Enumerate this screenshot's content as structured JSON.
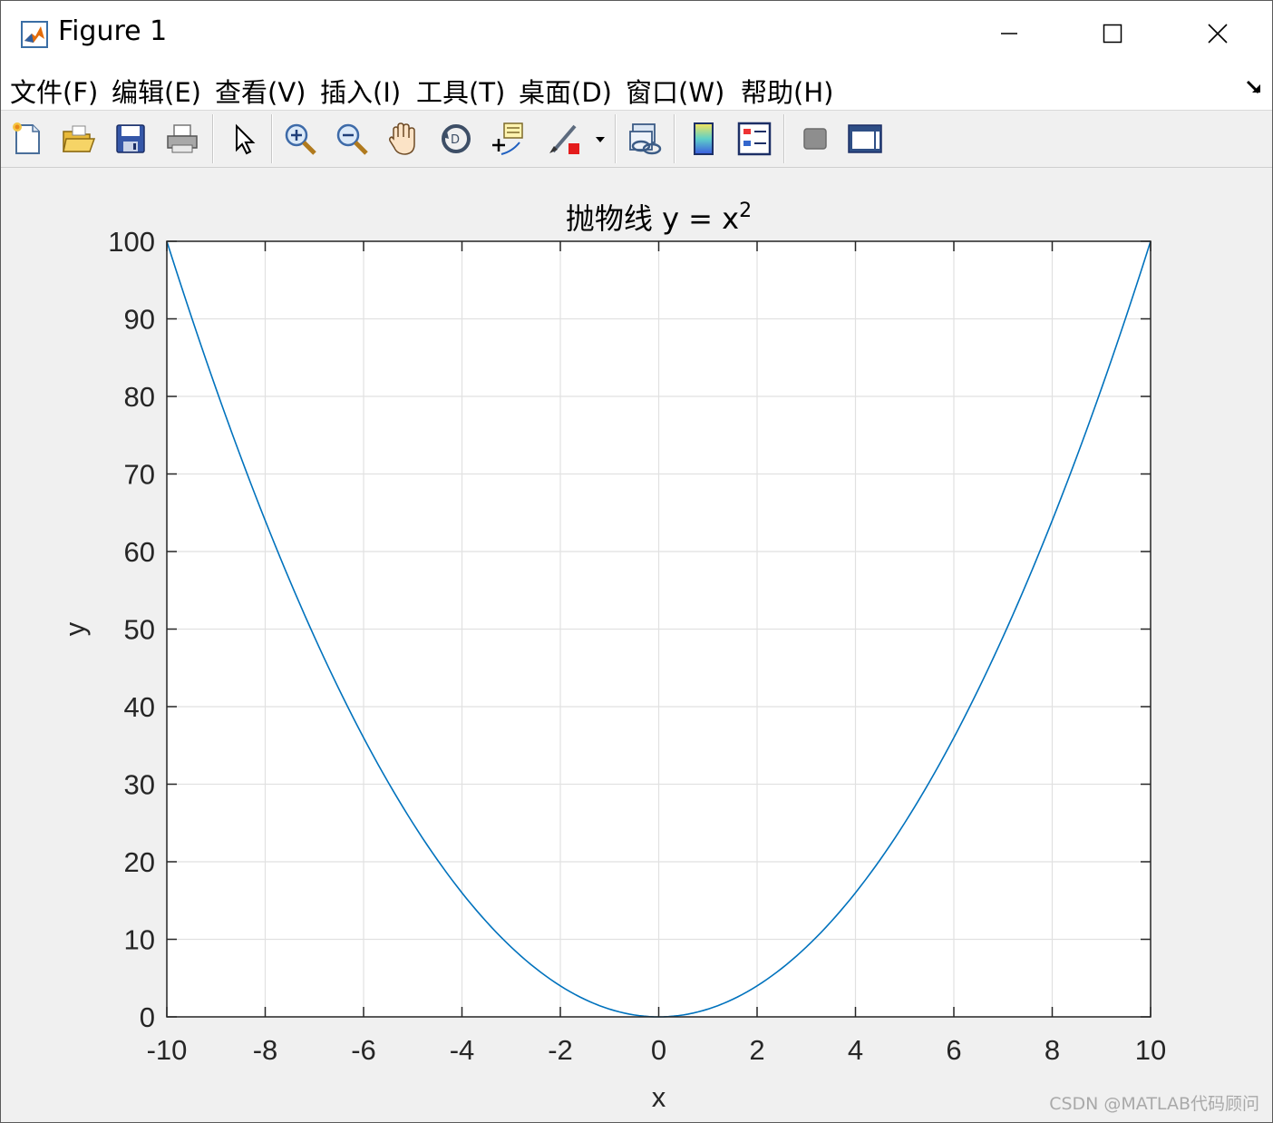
{
  "window": {
    "title": "Figure 1"
  },
  "menu": [
    "文件(F)",
    "编辑(E)",
    "查看(V)",
    "插入(I)",
    "工具(T)",
    "桌面(D)",
    "窗口(W)",
    "帮助(H)"
  ],
  "toolbar": [
    "new-figure-icon",
    "open-file-icon",
    "save-icon",
    "print-icon",
    "edit-plot-arrow-icon",
    "zoom-in-icon",
    "zoom-out-icon",
    "pan-hand-icon",
    "rotate-3d-icon",
    "data-cursor-icon",
    "brush-icon",
    "link-plot-icon",
    "colorbar-icon",
    "legend-icon",
    "hide-plot-tools-icon",
    "show-plot-tools-icon"
  ],
  "chart_data": {
    "type": "line",
    "title_main": "抛物线 y = x",
    "title_superscript": "2",
    "xlabel": "x",
    "ylabel": "y",
    "xlim": [
      -10,
      10
    ],
    "ylim": [
      0,
      100
    ],
    "xticks": [
      -10,
      -8,
      -6,
      -4,
      -2,
      0,
      2,
      4,
      6,
      8,
      10
    ],
    "yticks": [
      0,
      10,
      20,
      30,
      40,
      50,
      60,
      70,
      80,
      90,
      100
    ],
    "grid": true,
    "series": [
      {
        "function": "y = x^2",
        "color": "#0072BD",
        "x": [
          -10,
          -9,
          -8,
          -7,
          -6,
          -5,
          -4,
          -3,
          -2,
          -1,
          0,
          1,
          2,
          3,
          4,
          5,
          6,
          7,
          8,
          9,
          10
        ],
        "y": [
          100,
          81,
          64,
          49,
          36,
          25,
          16,
          9,
          4,
          1,
          0,
          1,
          4,
          9,
          16,
          25,
          36,
          49,
          64,
          81,
          100
        ]
      }
    ]
  },
  "watermark": "CSDN @MATLAB代码顾问"
}
